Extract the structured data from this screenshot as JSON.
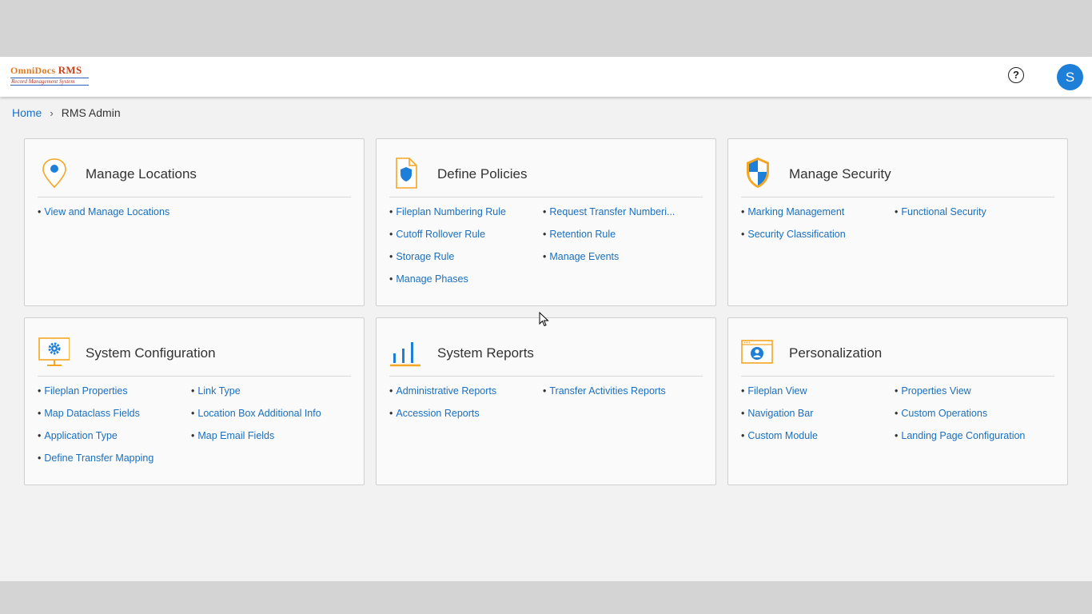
{
  "header": {
    "logo_main": "OmniDocs",
    "logo_rms": "RMS",
    "logo_sub": "Record Management System",
    "help_symbol": "?",
    "avatar_initial": "S"
  },
  "breadcrumb": {
    "home": "Home",
    "current": "RMS Admin"
  },
  "colors": {
    "accent": "#1e7fd8",
    "link": "#1a6fc0",
    "icon_orange": "#f5a623"
  },
  "cards": [
    {
      "title": "Manage Locations",
      "icon": "location-pin-icon",
      "links": [
        "View and Manage Locations"
      ]
    },
    {
      "title": "Define Policies",
      "icon": "policy-document-icon",
      "links": [
        "Fileplan Numbering Rule",
        "Request Transfer Numberi...",
        "Cutoff Rollover Rule",
        "Retention Rule",
        "Storage Rule",
        "Manage Events",
        "Manage Phases"
      ]
    },
    {
      "title": "Manage Security",
      "icon": "security-shield-icon",
      "links": [
        "Marking Management",
        "Functional Security",
        "Security Classification"
      ]
    },
    {
      "title": "System Configuration",
      "icon": "monitor-gear-icon",
      "links": [
        "Fileplan Properties",
        "Link Type",
        "Map Dataclass Fields",
        "Location Box Additional Info",
        "Application Type",
        "Map Email Fields",
        "Define Transfer Mapping"
      ]
    },
    {
      "title": "System Reports",
      "icon": "bar-chart-icon",
      "links": [
        "Administrative Reports",
        "Transfer Activities Reports",
        "Accession Reports"
      ]
    },
    {
      "title": "Personalization",
      "icon": "user-window-icon",
      "links": [
        "Fileplan View",
        "Properties View",
        "Navigation Bar",
        "Custom Operations",
        "Custom Module",
        "Landing Page Configuration"
      ]
    }
  ]
}
